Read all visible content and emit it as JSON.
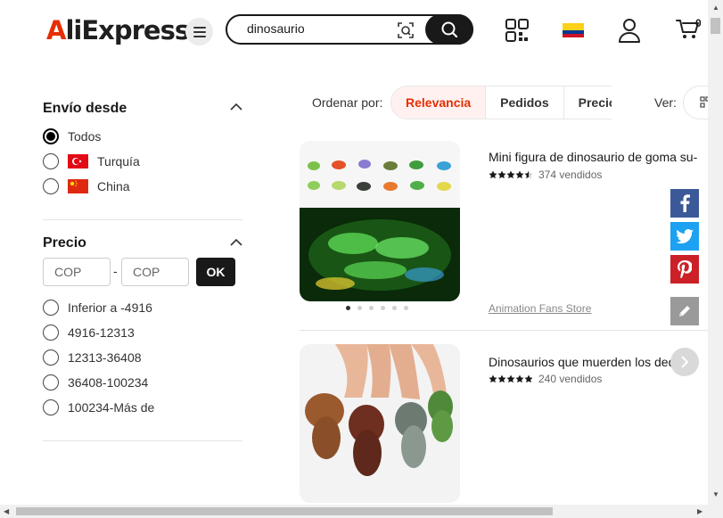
{
  "header": {
    "logo_text_a": "A",
    "logo_text_rest": "liExpress",
    "search_value": "dinosaurio",
    "cart_count": "0",
    "country_flag": "colombia-flag-icon"
  },
  "filters": {
    "shipping": {
      "title": "Envío desde",
      "options": [
        {
          "label": "Todos",
          "checked": true
        },
        {
          "label": "Turquía",
          "flag": "turkey-flag-icon"
        },
        {
          "label": "China",
          "flag": "china-flag-icon"
        }
      ]
    },
    "price": {
      "title": "Precio",
      "min_placeholder": "COP",
      "max_placeholder": "COP",
      "separator": "-",
      "ok_label": "OK",
      "ranges": [
        "Inferior a -4916",
        "4916-12313",
        "12313-36408",
        "36408-100234",
        "100234-Más de"
      ]
    }
  },
  "sort": {
    "label": "Ordenar por:",
    "tabs": [
      "Relevancia",
      "Pedidos",
      "Precio"
    ],
    "active": "Relevancia",
    "view_label": "Ver:"
  },
  "products": [
    {
      "title": "Mini figura de dinosaurio de goma su-",
      "rating": 4.5,
      "sold": "374 vendidos",
      "store": "Animation Fans Store"
    },
    {
      "title": "Dinosaurios que muerden los dedos, -",
      "rating": 5,
      "sold": "240 vendidos"
    }
  ],
  "colors": {
    "accent": "#e62e04",
    "facebook": "#3b5998",
    "twitter": "#1da1f2",
    "pinterest": "#cb2027",
    "edit": "#9a9a9a"
  }
}
